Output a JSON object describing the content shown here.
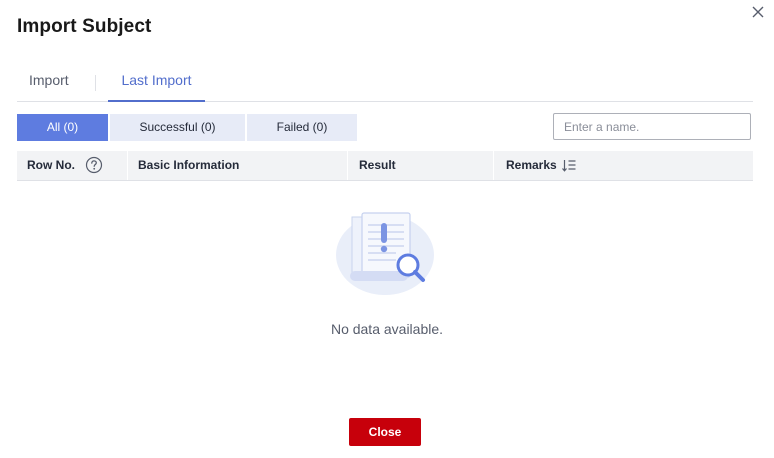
{
  "dialog": {
    "title": "Import Subject",
    "close_icon": "close-icon"
  },
  "tabs": [
    {
      "label": "Import",
      "active": false
    },
    {
      "label": "Last Import",
      "active": true
    }
  ],
  "filters": [
    {
      "label": "All (0)",
      "active": true
    },
    {
      "label": "Successful (0)",
      "active": false
    },
    {
      "label": "Failed (0)",
      "active": false
    }
  ],
  "search": {
    "placeholder": "Enter a name.",
    "value": ""
  },
  "table": {
    "columns": [
      {
        "label": "Row No.",
        "icon": "help-circle-icon"
      },
      {
        "label": "Basic Information"
      },
      {
        "label": "Result"
      },
      {
        "label": "Remarks",
        "icon": "sort-icon"
      }
    ],
    "rows": [],
    "empty_text": "No data available."
  },
  "footer": {
    "close_label": "Close"
  },
  "colors": {
    "accent": "#5e7ce0",
    "tab_active": "#526ecc",
    "danger": "#c7000b"
  }
}
